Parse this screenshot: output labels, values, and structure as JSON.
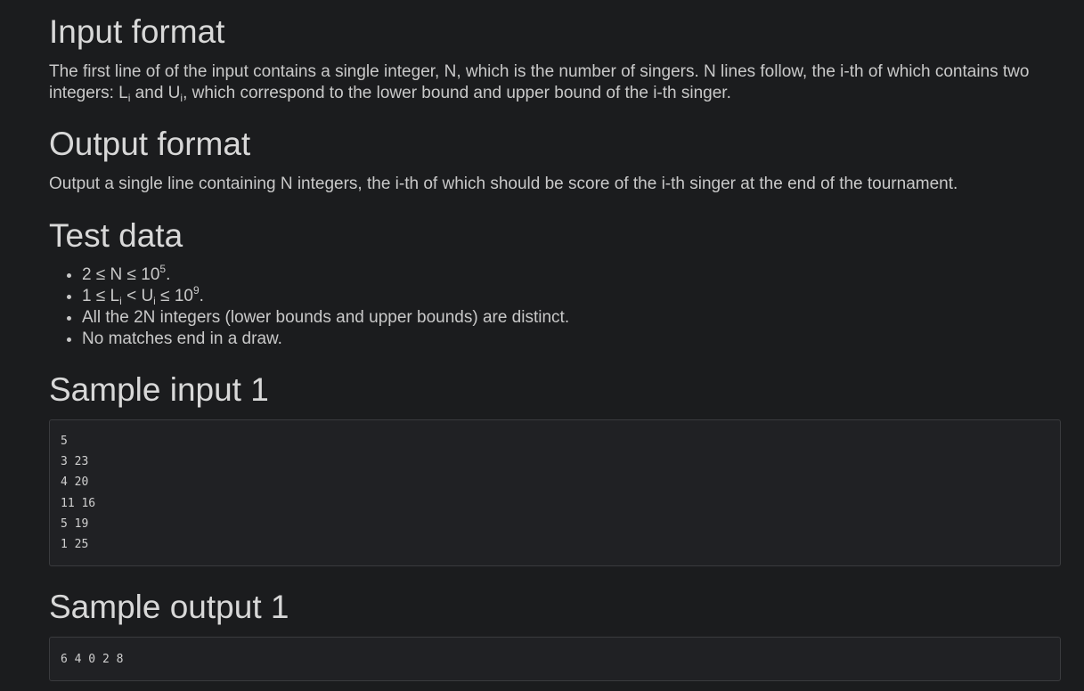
{
  "sections": {
    "input_format": {
      "title": "Input format",
      "p1": "The first line of of the input contains a single integer, N, which is the number of singers. N lines follow, the i-th of which contains two integers: L",
      "sub1": "i",
      "p2": " and U",
      "sub2": "i",
      "p3": ", which correspond to the lower bound and upper bound of the i-th singer."
    },
    "output_format": {
      "title": "Output format",
      "text": "Output a single line containing N integers, the i-th of which should be score of the i-th singer at the end of the tournament."
    },
    "test_data": {
      "title": "Test data",
      "item1_a": "2 ≤ N ≤ 10",
      "item1_sup": "5",
      "item1_b": ".",
      "item2_a": "1 ≤ L",
      "item2_sub1": "i",
      "item2_b": " < U",
      "item2_sub2": "i",
      "item2_c": " ≤ 10",
      "item2_sup": "9",
      "item2_d": ".",
      "item3": "All the 2N integers (lower bounds and upper bounds) are distinct.",
      "item4": "No matches end in a draw."
    },
    "sample_input": {
      "title": "Sample input 1",
      "code": "5\n3 23\n4 20\n11 16\n5 19\n1 25"
    },
    "sample_output": {
      "title": "Sample output 1",
      "code": "6 4 0 2 8"
    }
  }
}
